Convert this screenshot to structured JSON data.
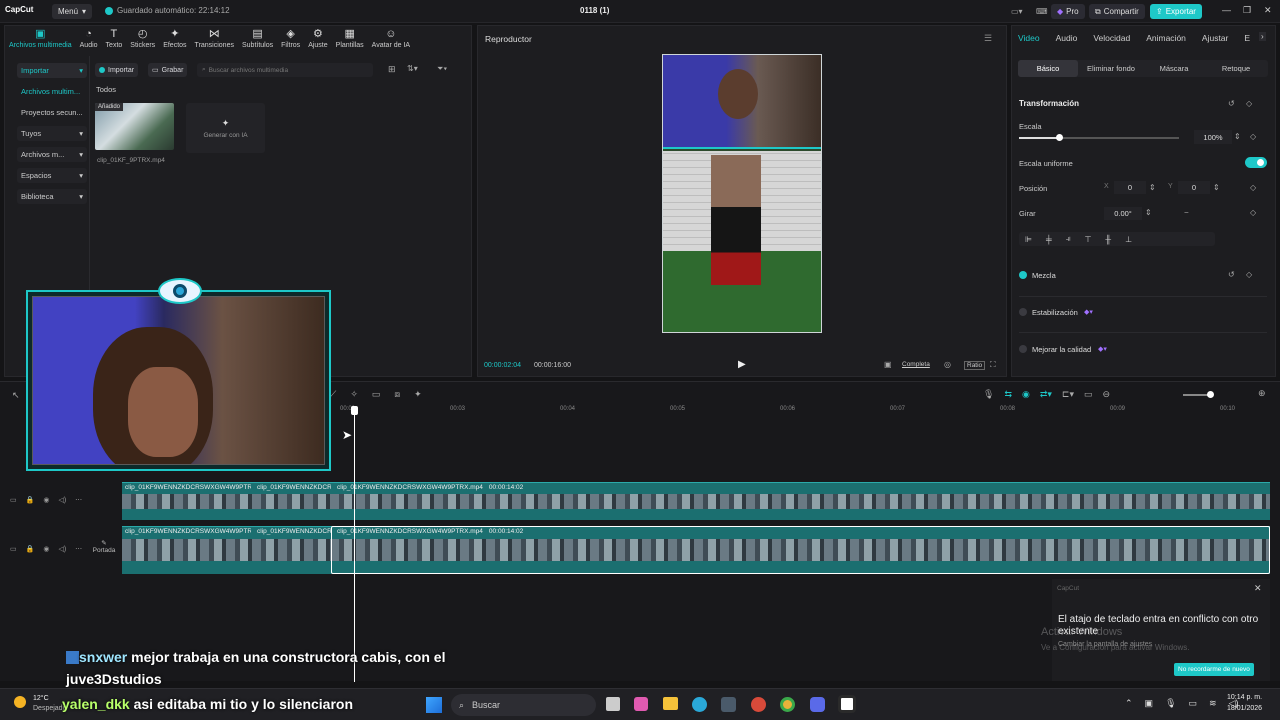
{
  "titlebar": {
    "logo": "CapCut",
    "menu": "Menú",
    "autosave": "Guardado automático: 22:14:12",
    "title": "0118 (1)",
    "pro": "Pro",
    "share": "Compartir",
    "export": "Exportar"
  },
  "media_toolbar": [
    {
      "label": "Archivos multimedia",
      "icon": "media-icon"
    },
    {
      "label": "Audio",
      "icon": "audio-icon"
    },
    {
      "label": "Texto",
      "icon": "text-icon"
    },
    {
      "label": "Stickers",
      "icon": "stickers-icon"
    },
    {
      "label": "Efectos",
      "icon": "effects-icon"
    },
    {
      "label": "Transiciones",
      "icon": "transitions-icon"
    },
    {
      "label": "Subtítulos",
      "icon": "subtitles-icon"
    },
    {
      "label": "Filtros",
      "icon": "filters-icon"
    },
    {
      "label": "Ajuste",
      "icon": "adjust-icon"
    },
    {
      "label": "Plantillas",
      "icon": "templates-icon"
    },
    {
      "label": "Avatar de IA",
      "icon": "ai-avatar-icon"
    }
  ],
  "media_sidebar": [
    {
      "label": "Importar"
    },
    {
      "label": "Archivos multim..."
    },
    {
      "label": "Proyectos secun..."
    },
    {
      "label": "Tuyos"
    },
    {
      "label": "Archivos m..."
    },
    {
      "label": "Espacios"
    },
    {
      "label": "Biblioteca"
    }
  ],
  "media": {
    "import": "Importar",
    "record": "Grabar",
    "search_placeholder": "Buscar archivos multimedia",
    "all": "Todos",
    "added_badge": "Añadido",
    "clip_name": "clip_01KF_9PTRX.mp4",
    "generate_ai": "Generar con IA"
  },
  "player": {
    "title": "Reproductor",
    "current_time": "00:00:02:04",
    "total_time": "00:00:16:00",
    "full_label": "Completa",
    "ratio_label": "Ratio"
  },
  "props": {
    "tabs": [
      "Video",
      "Audio",
      "Velocidad",
      "Animación",
      "Ajustar",
      "E"
    ],
    "subtabs": [
      "Básico",
      "Eliminar fondo",
      "Máscara",
      "Retoque"
    ],
    "transform": "Transformación",
    "scale_label": "Escala",
    "scale_value": "100%",
    "scale_fraction": 0.1,
    "uniform_scale": "Escala uniforme",
    "position": "Posición",
    "pos_x_label": "X",
    "pos_x": "0",
    "pos_y_label": "Y",
    "pos_y": "0",
    "rotate": "Girar",
    "rotate_value": "0.00°",
    "blend": "Mezcla",
    "stabilize": "Estabilización",
    "enhance": "Mejorar la calidad"
  },
  "timeline": {
    "ruler": [
      "00:00",
      "00:03",
      "00:04",
      "00:05",
      "00:06",
      "00:07",
      "00:08",
      "00:09",
      "00:10"
    ],
    "clip_a": "clip_01KF9WENNZKDCRSWXGW4W9PTRI",
    "clip_b": "clip_01KF9WENNZKDCRS",
    "clip_c": "clip_01KF9WENNZKDCRSWXGW4W9PTRX.mp4",
    "clip_c_dur": "00:00:14:02",
    "cover": "Portada"
  },
  "toast": {
    "app": "CapCut",
    "message": "El atajo de teclado entra en conflicto con otro existente",
    "sub": "Cambiar la pantalla de ajustes",
    "button": "No recordarme de nuevo"
  },
  "watermark": {
    "line1": "Activar Windows",
    "line2": "Ve a Configuración para activar Windows."
  },
  "chat": [
    {
      "user": "snxwer",
      "text": "mejor trabaja en una constructora cabis, con el juve3Dstudios"
    },
    {
      "user": "yalen_dkk",
      "text": "asi editaba mi tio y lo silenciaron"
    }
  ],
  "taskbar": {
    "weather_temp": "12°C",
    "weather_desc": "Despejado",
    "search": "Buscar",
    "time": "10:14 p. m.",
    "date": "18/01/2026"
  },
  "colors": {
    "accent": "#1ec8c8",
    "bg": "#141416",
    "panel": "#1d1d20"
  }
}
